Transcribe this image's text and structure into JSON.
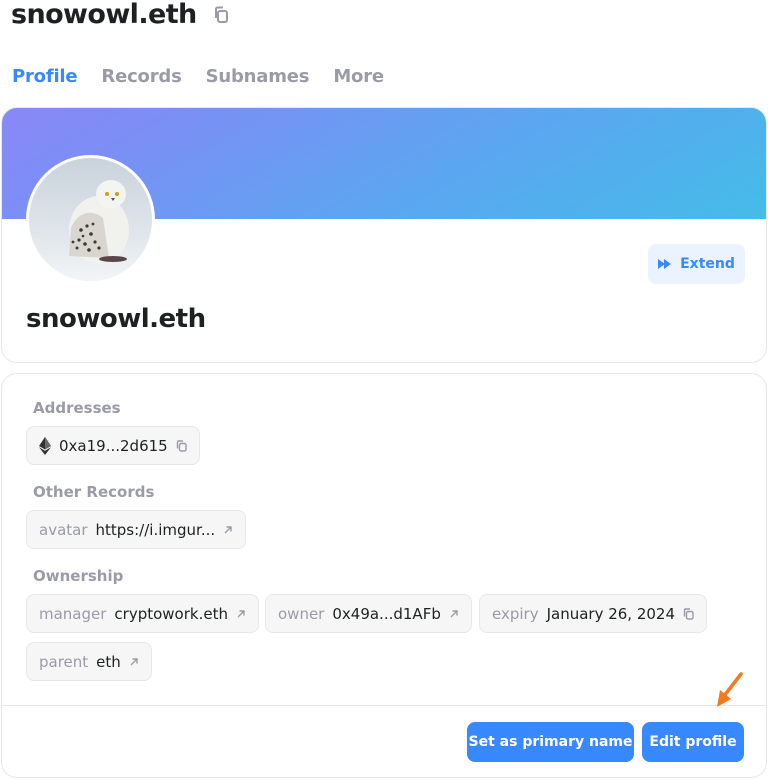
{
  "header": {
    "title": "snowowl.eth"
  },
  "tabs": [
    {
      "label": "Profile",
      "active": true
    },
    {
      "label": "Records"
    },
    {
      "label": "Subnames"
    },
    {
      "label": "More"
    }
  ],
  "profile": {
    "name": "snowowl.eth",
    "extend_label": "Extend"
  },
  "records": {
    "addresses_label": "Addresses",
    "address": {
      "coin_icon": "ethereum-icon",
      "value": "0xa19...2d615"
    },
    "other_label": "Other Records",
    "avatar": {
      "key": "avatar",
      "value": "https://i.imgur..."
    },
    "ownership_label": "Ownership",
    "manager": {
      "key": "manager",
      "value": "cryptowork.eth"
    },
    "owner": {
      "key": "owner",
      "value": "0x49a...d1AFb"
    },
    "expiry": {
      "key": "expiry",
      "value": "January 26, 2024"
    },
    "parent": {
      "key": "parent",
      "value": "eth"
    }
  },
  "actions": {
    "primary_label": "Set as primary name",
    "edit_label": "Edit profile"
  },
  "colors": {
    "accent": "#3889ff",
    "muted": "#9b9ba7",
    "annotation_arrow": "#f7781d"
  }
}
